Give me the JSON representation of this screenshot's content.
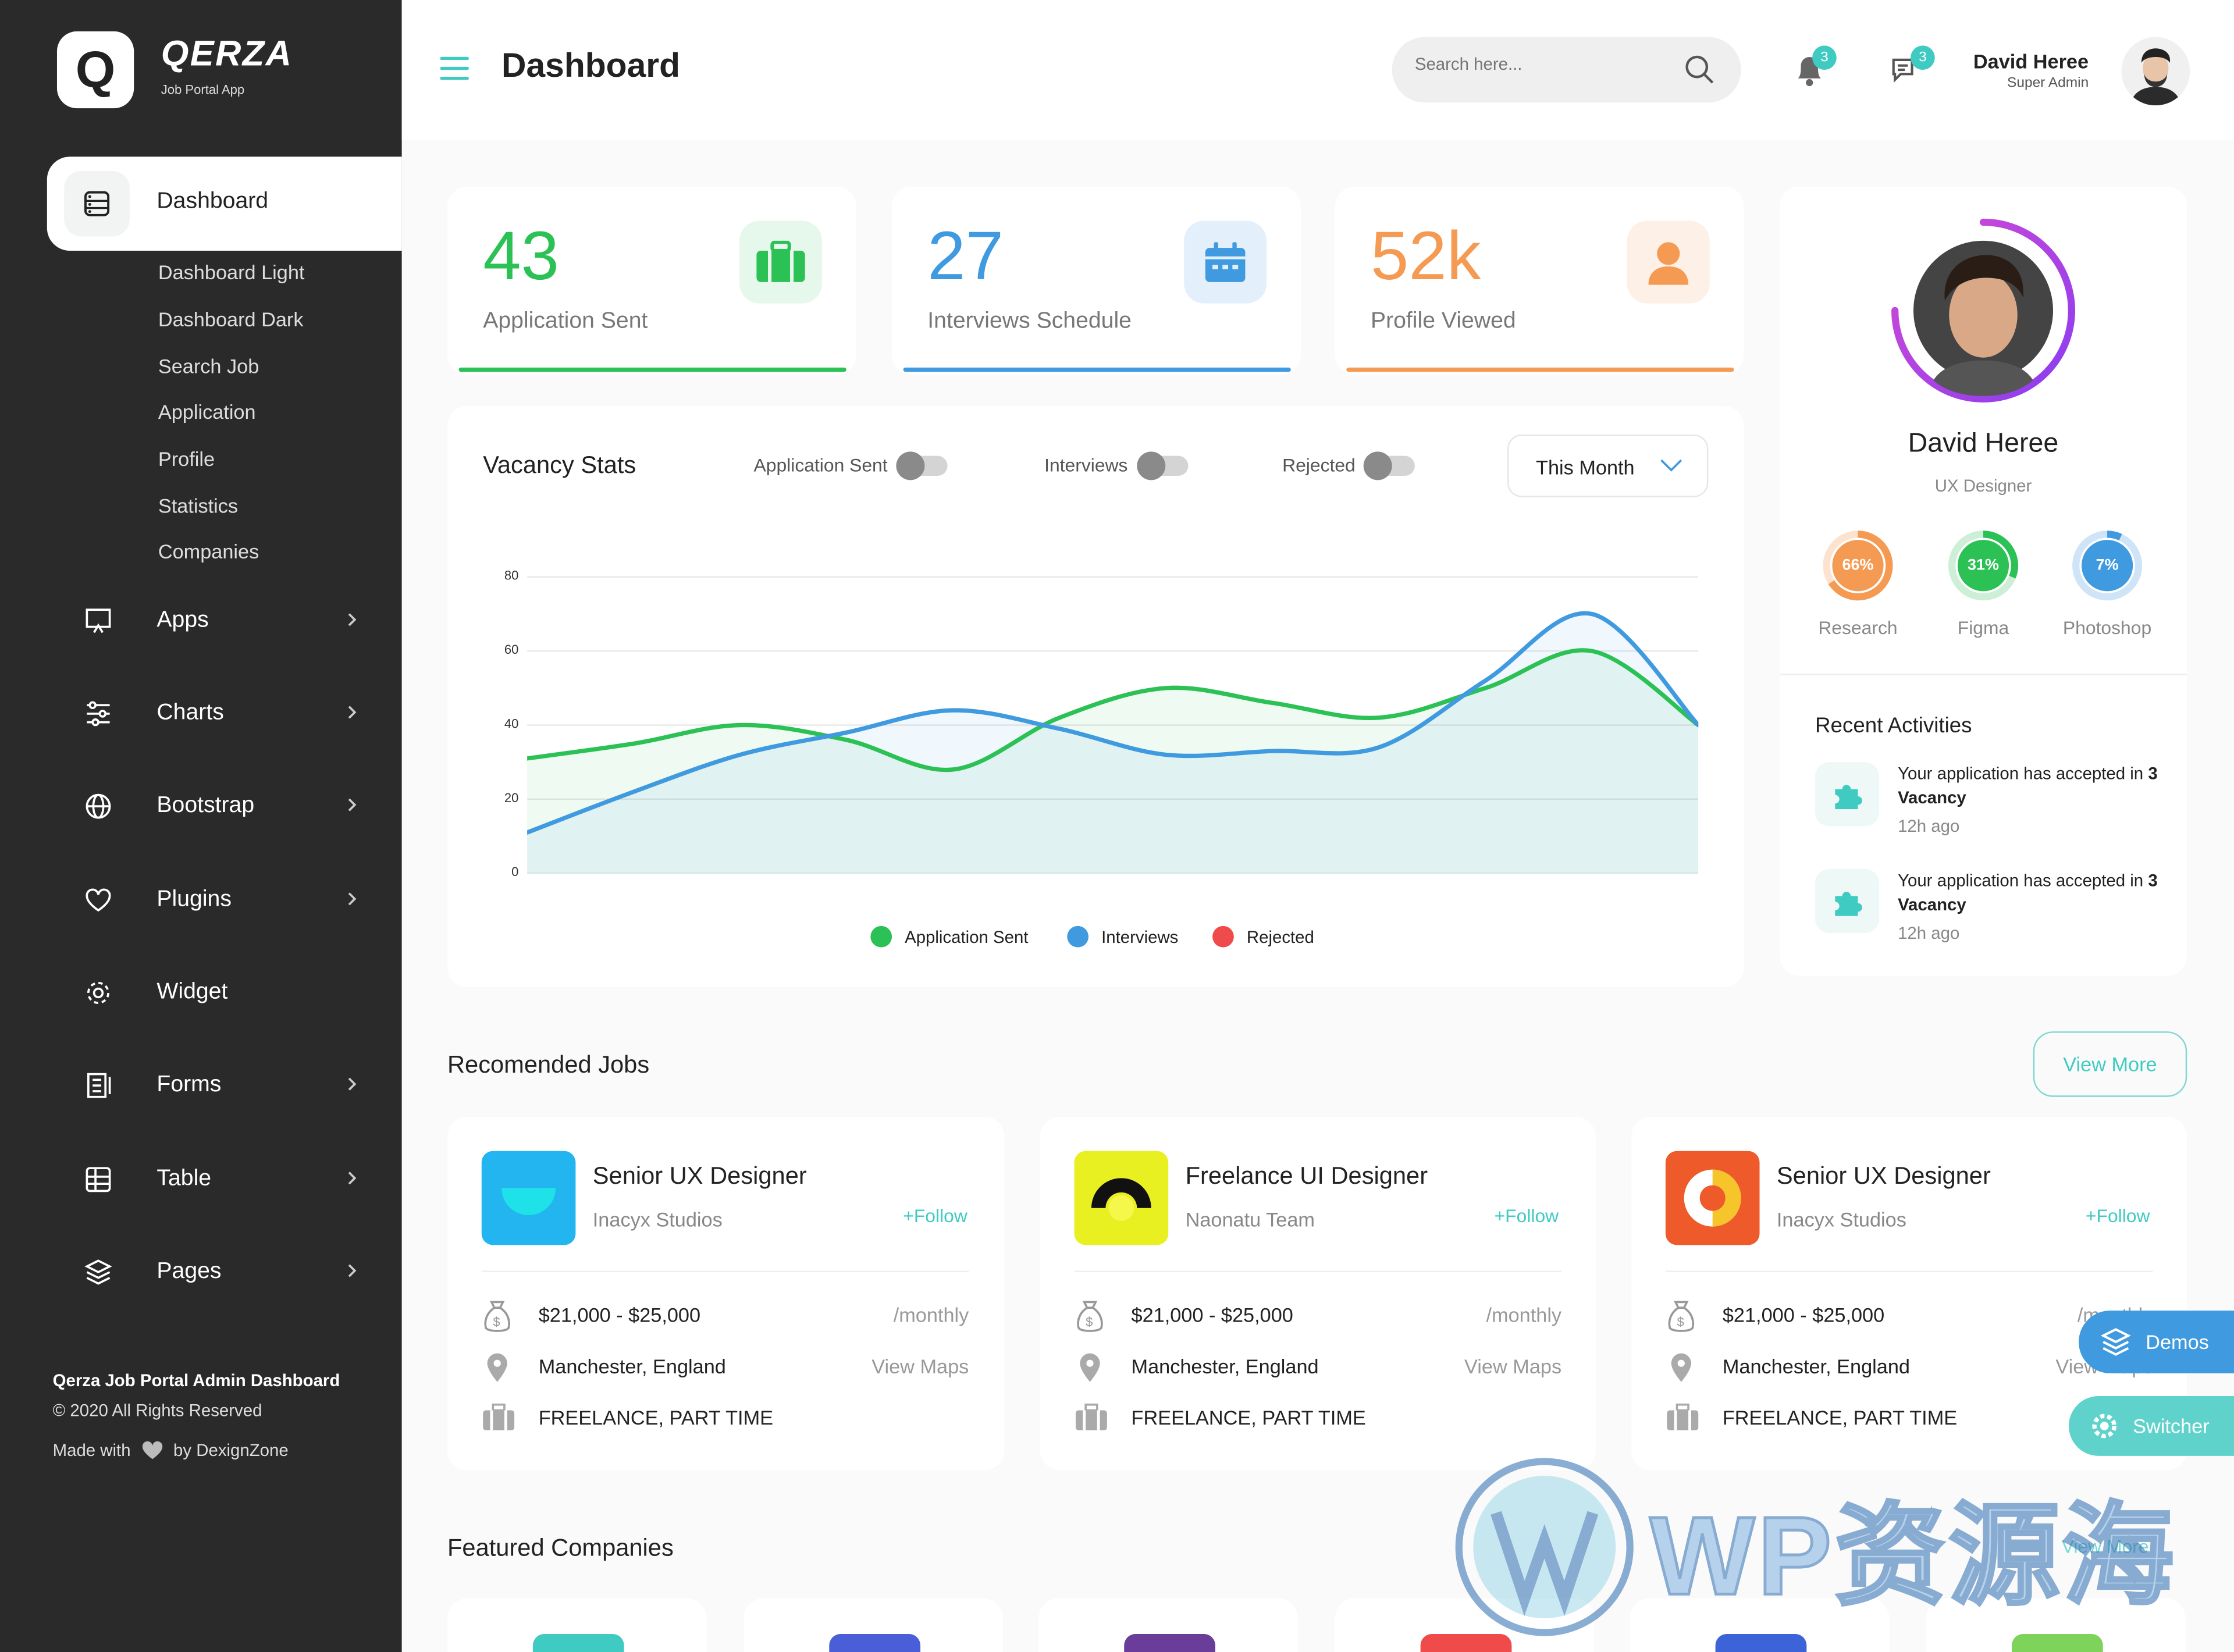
{
  "brand": {
    "logo_letter": "Q",
    "name": "QERZA",
    "tagline": "Job Portal App"
  },
  "sidebar": {
    "active": {
      "label": "Dashboard",
      "icon": "dashboard-icon"
    },
    "submenu": [
      "Dashboard Light",
      "Dashboard Dark",
      "Search Job",
      "Application",
      "Profile",
      "Statistics",
      "Companies"
    ],
    "items": [
      {
        "label": "Apps",
        "icon": "monitor-icon"
      },
      {
        "label": "Charts",
        "icon": "sliders-icon"
      },
      {
        "label": "Bootstrap",
        "icon": "globe-icon"
      },
      {
        "label": "Plugins",
        "icon": "heart-icon"
      },
      {
        "label": "Widget",
        "icon": "gear-icon"
      },
      {
        "label": "Forms",
        "icon": "form-icon"
      },
      {
        "label": "Table",
        "icon": "table-icon"
      },
      {
        "label": "Pages",
        "icon": "layers-icon"
      }
    ],
    "footer": {
      "title": "Qerza Job Portal Admin Dashboard",
      "copyright": "© 2020 All Rights Reserved",
      "made_with": "Made with",
      "by": "by DexignZone"
    }
  },
  "header": {
    "title": "Dashboard",
    "search_placeholder": "Search here...",
    "notifications_count": "3",
    "messages_count": "3",
    "user_name": "David Heree",
    "user_role": "Super Admin"
  },
  "stats": [
    {
      "value": "43",
      "label": "Application Sent",
      "color": "#2bc155",
      "bg": "#e6f8ec",
      "icon": "briefcase-icon"
    },
    {
      "value": "27",
      "label": "Interviews Schedule",
      "color": "#3f9ae0",
      "bg": "#e3f0fb",
      "icon": "calendar-icon"
    },
    {
      "value": "52k",
      "label": "Profile Viewed",
      "color": "#f59a52",
      "bg": "#fdf0e6",
      "icon": "user-icon"
    }
  ],
  "vacancy": {
    "title": "Vacancy Stats",
    "toggles": [
      "Application Sent",
      "Interviews",
      "Rejected"
    ],
    "period": "This Month",
    "legend": [
      {
        "name": "Application Sent",
        "color": "#2bc155"
      },
      {
        "name": "Interviews",
        "color": "#3f9ae0"
      },
      {
        "name": "Rejected",
        "color": "#f04b4b"
      }
    ]
  },
  "chart_data": {
    "type": "area",
    "ylim": [
      0,
      80
    ],
    "yticks": [
      0,
      20,
      40,
      60,
      80
    ],
    "grid": true,
    "legend_position": "bottom",
    "x": [
      0,
      1,
      2,
      3,
      4,
      5,
      6,
      7,
      8,
      9,
      10,
      11
    ],
    "series": [
      {
        "name": "Application Sent",
        "color": "#2bc155",
        "values": [
          31,
          35,
          40,
          36,
          28,
          42,
          50,
          46,
          42,
          50,
          60,
          40
        ]
      },
      {
        "name": "Interviews",
        "color": "#3f9ae0",
        "values": [
          11,
          22,
          32,
          38,
          44,
          39,
          32,
          33,
          34,
          52,
          70,
          40
        ]
      }
    ]
  },
  "profile": {
    "name": "David Heree",
    "role": "UX Designer",
    "skills": [
      {
        "label": "Research",
        "percent": 66,
        "text": "66%",
        "color": "#f59a52",
        "track": "#fde3cf"
      },
      {
        "label": "Figma",
        "percent": 31,
        "text": "31%",
        "color": "#2bc155",
        "track": "#cdeed7"
      },
      {
        "label": "Photoshop",
        "percent": 7,
        "text": "7%",
        "color": "#3f9ae0",
        "track": "#cfe4f7"
      }
    ]
  },
  "recent": {
    "title": "Recent Activities",
    "items": [
      {
        "text": "Your application has accepted in",
        "bold": "3 Vacancy",
        "time": "12h ago"
      },
      {
        "text": "Your application has accepted in",
        "bold": "3 Vacancy",
        "time": "12h ago"
      }
    ]
  },
  "jobs": {
    "title": "Recomended Jobs",
    "view_more": "View More",
    "items": [
      {
        "title": "Senior UX Designer",
        "company": "Inacyx Studios",
        "follow": "+Follow",
        "salary": "$21,000 - $25,000",
        "period": "/monthly",
        "location": "Manchester, England",
        "maps": "View Maps",
        "type": "FREELANCE, PART TIME"
      },
      {
        "title": "Freelance UI Designer",
        "company": "Naonatu Team",
        "follow": "+Follow",
        "salary": "$21,000 - $25,000",
        "period": "/monthly",
        "location": "Manchester, England",
        "maps": "View Maps",
        "type": "FREELANCE, PART TIME"
      },
      {
        "title": "Senior UX Designer",
        "company": "Inacyx Studios",
        "follow": "+Follow",
        "salary": "$21,000 - $25,000",
        "period": "/monthly",
        "location": "Manchester, England",
        "maps": "View Maps",
        "type": "FREELANCE, PART TIME"
      }
    ]
  },
  "featured": {
    "title": "Featured Companies",
    "view_more": "View More"
  },
  "floating": {
    "demos": "Demos",
    "switcher": "Switcher"
  },
  "watermark": "WP资源海"
}
